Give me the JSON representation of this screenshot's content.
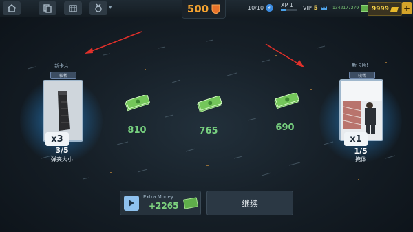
{
  "topbar": {
    "currency_center": "500",
    "energy": "10/10",
    "xp_label": "XP 1",
    "xp_progress": 0.3,
    "vip_label": "VIP",
    "vip_level": "5",
    "cash": "1342177279",
    "gold": "9999",
    "add_label": "+"
  },
  "cards": [
    {
      "new_label": "新卡片!",
      "rarity": "较稀",
      "multiplier": "x3",
      "progress": "3/5",
      "name": "弹夹大小"
    },
    {
      "new_label": "新卡片!",
      "rarity": "较稀",
      "multiplier": "x1",
      "progress": "1/5",
      "name": "掩体"
    }
  ],
  "rewards": [
    {
      "value": "810"
    },
    {
      "value": "765"
    },
    {
      "value": "690"
    }
  ],
  "extra": {
    "label": "Extra Money",
    "value": "+2265"
  },
  "continue_label": "继续",
  "colors": {
    "accent_orange": "#f3a230",
    "cash_green": "#77d07f",
    "glow_blue": "#50c8ff",
    "gold": "#f4d24a"
  }
}
